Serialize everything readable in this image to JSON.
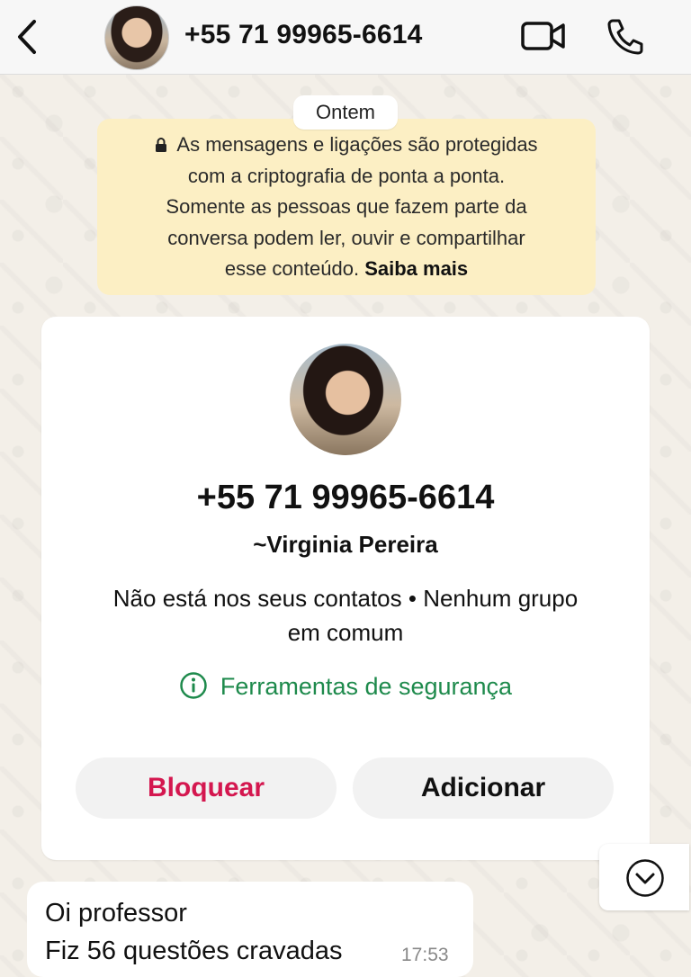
{
  "header": {
    "title": "+55 71 99965-6614",
    "icons": {
      "back": "chevron-left-icon",
      "video": "video-camera-icon",
      "call": "phone-icon"
    }
  },
  "chat": {
    "date_chip": "Ontem",
    "encryption_notice": {
      "lines": [
        "As mensagens e ligações são protegidas",
        "com a criptografia de ponta a ponta.",
        "Somente as pessoas que fazem parte da",
        "conversa podem ler, ouvir e compartilhar",
        "esse conteúdo."
      ],
      "link": "Saiba mais"
    },
    "contact_card": {
      "phone": "+55 71 99965-6614",
      "name": "~Virginia Pereira",
      "info_line1": "Não está nos seus contatos • Nenhum grupo",
      "info_line2": "em comum",
      "safety_tools": "Ferramentas de segurança",
      "block_label": "Bloquear",
      "add_label": "Adicionar"
    },
    "message": {
      "lines": [
        "Oi professor",
        "Fiz 56 questões cravadas"
      ],
      "time": "17:53"
    }
  },
  "colors": {
    "block_red": "#d4174f",
    "safety_green": "#1e8a4c",
    "notice_bg": "#fcefc4"
  }
}
